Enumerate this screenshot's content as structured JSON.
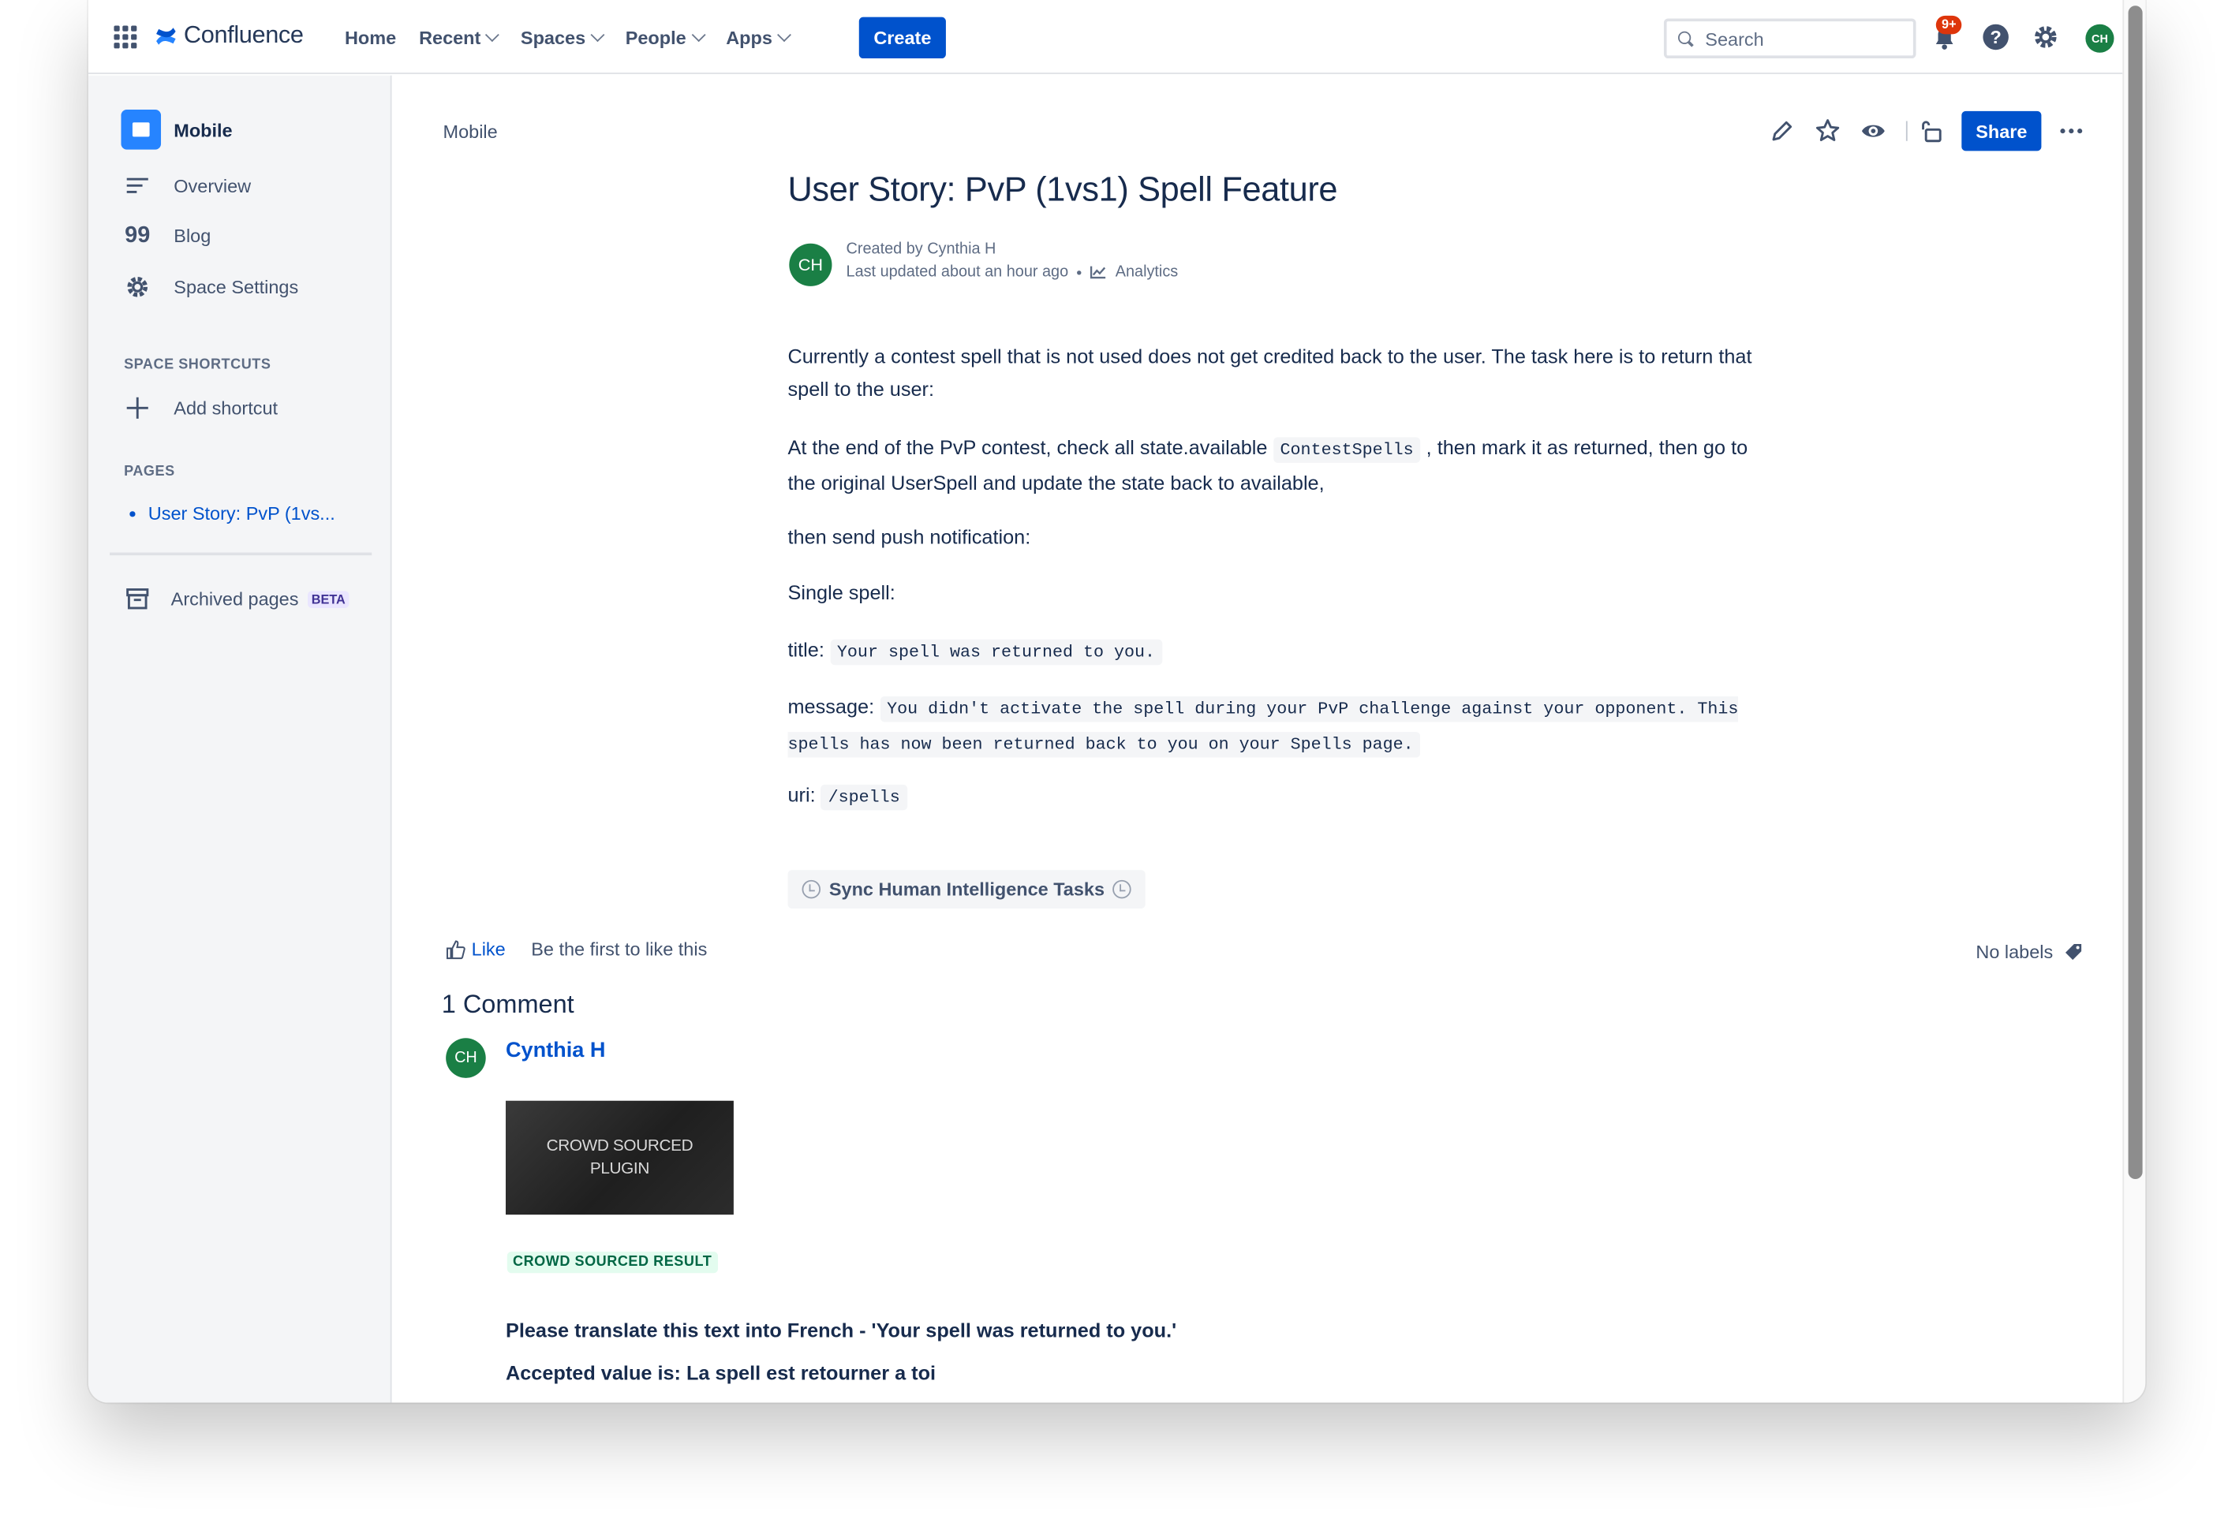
{
  "topnav": {
    "logo_text": "Confluence",
    "items": [
      {
        "label": "Home",
        "dropdown": false
      },
      {
        "label": "Recent",
        "dropdown": true
      },
      {
        "label": "Spaces",
        "dropdown": true
      },
      {
        "label": "People",
        "dropdown": true
      },
      {
        "label": "Apps",
        "dropdown": true
      }
    ],
    "create_label": "Create",
    "search_placeholder": "Search",
    "notifications_badge": "9+",
    "user_initials": "CH"
  },
  "sidebar": {
    "space_name": "Mobile",
    "items": [
      {
        "label": "Overview",
        "icon": "overview-lines-icon"
      },
      {
        "label": "Blog",
        "icon": "quote-icon"
      },
      {
        "label": "Space Settings",
        "icon": "gear-icon"
      }
    ],
    "shortcuts_heading": "SPACE SHORTCUTS",
    "add_shortcut_label": "Add shortcut",
    "pages_heading": "PAGES",
    "page_link": "User Story: PvP (1vs...",
    "archived_label": "Archived pages",
    "archived_badge": "BETA"
  },
  "page": {
    "breadcrumb": "Mobile",
    "share_label": "Share",
    "title": "User Story: PvP (1vs1) Spell Feature",
    "author_initials": "CH",
    "created_by": "Created by Cynthia H",
    "last_updated": "Last updated about an hour ago",
    "analytics_label": "Analytics",
    "body": {
      "p1": "Currently a contest spell that is not used does not get credited back to the user. The task here is to return that spell to the user:",
      "p2_a": "At the end of the PvP contest, check all state.available",
      "p2_code": "ContestSpells",
      "p2_b": ", then mark it as returned, then go to the original UserSpell and update the state back to available,",
      "p3": "then send push notification:",
      "p4": "Single spell:",
      "title_label": "title:",
      "title_code": "Your spell was returned to you.",
      "message_label": "message:",
      "message_code": "You didn't activate the spell during your PvP challenge against your opponent. This spells has now been returned back to you on your Spells page.",
      "uri_label": "uri:",
      "uri_code": "/spells"
    },
    "macro_label": "Sync Human Intelligence Tasks",
    "like_label": "Like",
    "like_text": "Be the first to like this",
    "labels_text": "No labels"
  },
  "comments": {
    "count_label": "1 Comment",
    "author_initials": "CH",
    "author": "Cynthia H",
    "image_text_line1": "CROWD SOURCED",
    "image_text_line2": "PLUGIN",
    "lozenge": "CROWD SOURCED RESULT",
    "line1": "Please translate this text into French - 'Your spell was returned to you.'",
    "line2": "Accepted value is: La spell est retourner  a toi"
  }
}
